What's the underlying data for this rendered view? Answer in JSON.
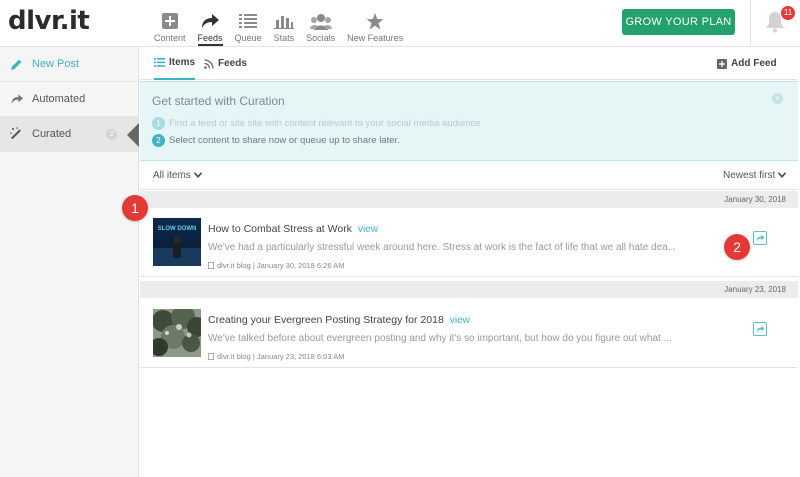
{
  "app": {
    "logo": "dlvr.it"
  },
  "nav": [
    {
      "label": "Content",
      "icon": "plus-square-icon"
    },
    {
      "label": "Feeds",
      "icon": "share-arrow-icon",
      "active": true
    },
    {
      "label": "Queue",
      "icon": "list-icon"
    },
    {
      "label": "Stats",
      "icon": "bar-chart-icon"
    },
    {
      "label": "Socials",
      "icon": "users-icon"
    },
    {
      "label": "New Features",
      "icon": "star-icon"
    }
  ],
  "header": {
    "grow_button": "GROW YOUR PLAN",
    "notification_count": "11"
  },
  "sidebar": {
    "items": [
      {
        "label": "New Post",
        "icon": "pencil-icon"
      },
      {
        "label": "Automated",
        "icon": "share-arrow-icon"
      },
      {
        "label": "Curated",
        "icon": "magic-wand-icon",
        "count": "2",
        "active": true
      }
    ]
  },
  "tabs": {
    "items": "Items",
    "feeds": "Feeds",
    "add_feed": "Add Feed"
  },
  "banner": {
    "title": "Get started with Curation",
    "close": "×",
    "steps": [
      {
        "num": "1",
        "text": "Find a feed or site site with content relevant to your social media audience"
      },
      {
        "num": "2",
        "text": "Select content to share now or queue up to share later."
      }
    ]
  },
  "filters": {
    "left": "All items",
    "right": "Newest first"
  },
  "groups": [
    {
      "date": "January 30, 2018",
      "post": {
        "title": "How to Combat Stress at Work",
        "view": "view",
        "excerpt": "We've had a particularly stressful week around here. Stress at work is the fact of life that we all hate dea...",
        "meta": "dlvr.it blog | January 30, 2018 6:26 AM",
        "thumb_text": "SLOW DOWN"
      }
    },
    {
      "date": "January 23, 2018",
      "post": {
        "title": "Creating your Evergreen Posting Strategy for 2018",
        "view": "view",
        "excerpt": "We've talked before about evergreen posting and why it's so important, but how do you figure out what ...",
        "meta": "dlvr.it blog | January 23, 2018 6:03 AM"
      }
    }
  ],
  "callouts": [
    "1",
    "2"
  ],
  "colors": {
    "accent": "#3fb3c4",
    "grow": "#23a26b",
    "callout": "#e53935",
    "banner_bg": "#e6f5f6"
  }
}
